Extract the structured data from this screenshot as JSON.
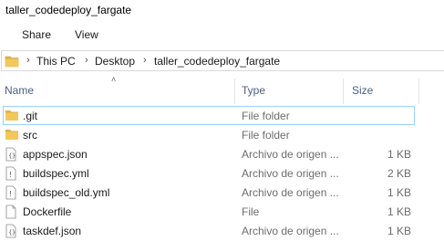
{
  "window": {
    "title": "taller_codedeploy_fargate"
  },
  "ribbon": {
    "tabs": [
      {
        "label": "Share"
      },
      {
        "label": "View"
      }
    ]
  },
  "address": {
    "crumbs": [
      {
        "label": "This PC"
      },
      {
        "label": "Desktop"
      },
      {
        "label": "taller_codedeploy_fargate"
      }
    ]
  },
  "columns": {
    "name": "Name",
    "type": "Type",
    "size": "Size"
  },
  "files": [
    {
      "name": ".git",
      "type": "File folder",
      "size": "",
      "icon": "folder-icon"
    },
    {
      "name": "src",
      "type": "File folder",
      "size": "",
      "icon": "folder-icon"
    },
    {
      "name": "appspec.json",
      "type": "Archivo de origen ...",
      "size": "1 KB",
      "icon": "json-file-icon"
    },
    {
      "name": "buildspec.yml",
      "type": "Archivo de origen ...",
      "size": "2 KB",
      "icon": "yml-file-icon"
    },
    {
      "name": "buildspec_old.yml",
      "type": "Archivo de origen ...",
      "size": "1 KB",
      "icon": "yml-file-icon"
    },
    {
      "name": "Dockerfile",
      "type": "File",
      "size": "1 KB",
      "icon": "blank-file-icon"
    },
    {
      "name": "taskdef.json",
      "type": "Archivo de origen ...",
      "size": "1 KB",
      "icon": "json-file-icon"
    }
  ],
  "colors": {
    "folder": "#dcb04a",
    "header_text": "#4d6082",
    "selection_border": "#99d1ff"
  }
}
